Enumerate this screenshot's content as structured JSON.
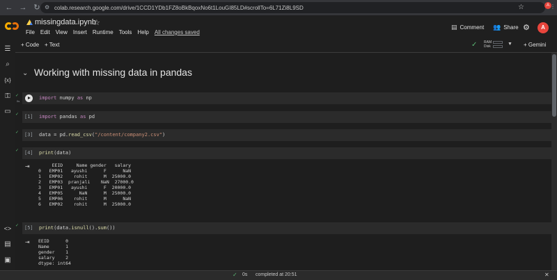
{
  "browser": {
    "url": "colab.research.google.com/drive/1CCD1YDb1FZ8oBkBqoxNo6t1LouGI85LD#scrollTo=6L71Zi8L9SD",
    "profile_initial": "A"
  },
  "header": {
    "title": "missingdata.ipynb",
    "menu": [
      "File",
      "Edit",
      "View",
      "Insert",
      "Runtime",
      "Tools",
      "Help"
    ],
    "saved_status": "All changes saved",
    "comment_label": "Comment",
    "share_label": "Share",
    "avatar_initial": "A"
  },
  "toolbar": {
    "code_label": "+ Code",
    "text_label": "+ Text",
    "ram_label": "RAM",
    "disk_label": "Disk",
    "gemini_label": "+ Gemini"
  },
  "notebook": {
    "section_title": "Working with missing data in pandas",
    "cells": [
      {
        "num": "",
        "code": "import numpy as np"
      },
      {
        "num": "[1]",
        "code": "import pandas as pd"
      },
      {
        "num": "[3]",
        "code": "data = pd.read_csv(\"/content/company2.csv\")"
      },
      {
        "num": "[4]",
        "code": "print(data)"
      },
      {
        "num": "[5]",
        "code": "print(data.isnull().sum())"
      }
    ],
    "exec_time": "0s",
    "output_print": "     EEID     Name gender   salary\n0   EMP01   ayushi      F      NaN\n1   EMP02    rohit      M  25000.0\n2   EMP03  pranjali    NaN  27000.0\n3   EMP01   ayushi      F  20000.0\n4   EMP05      NaN      M  25000.0\n5   EMP06    rohit      M      NaN\n6   EMP02    rohit      M  25000.0",
    "output_isnull": "EEID      0\nName      1\ngender    1\nsalary    2\ndtype: int64"
  },
  "status": {
    "time": "0s",
    "text": "completed at 20:51"
  }
}
